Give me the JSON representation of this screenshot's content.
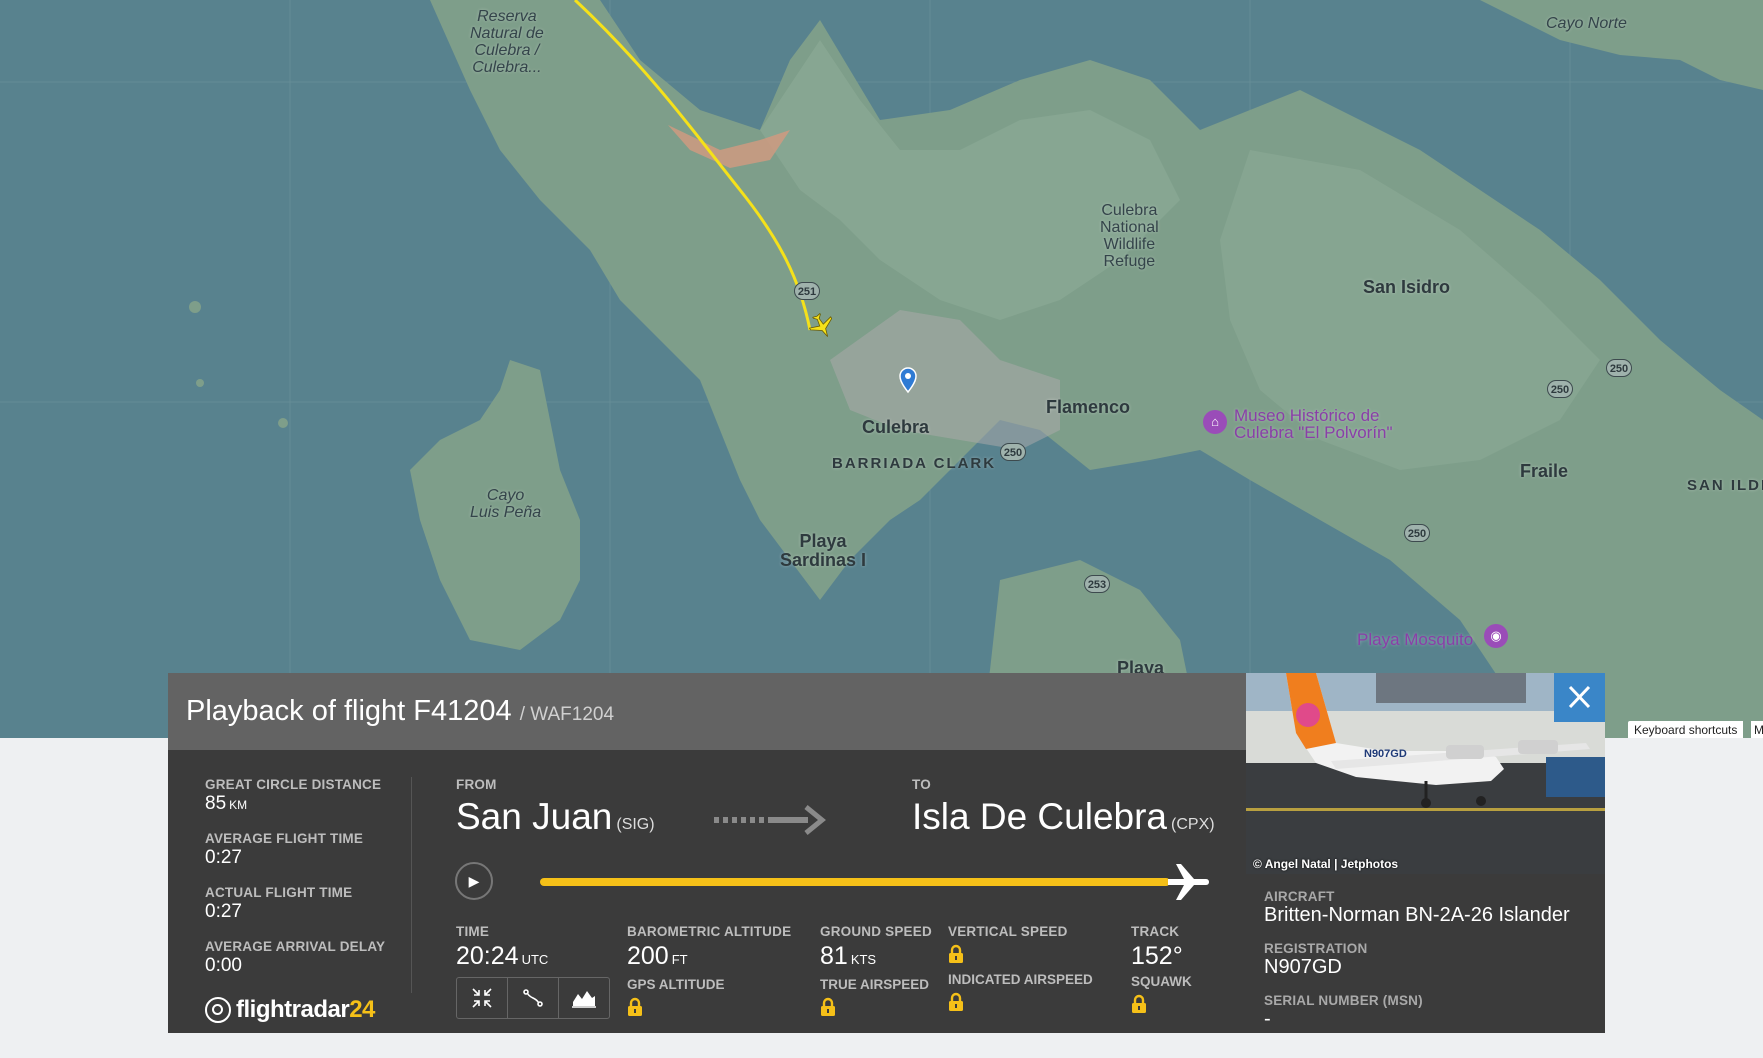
{
  "map": {
    "labels": {
      "reserva_line1": "Reserva",
      "reserva_line2": "Natural de",
      "reserva_line3": "Culebra /",
      "reserva_line4": "Culebra...",
      "cayo_norte": "Cayo Norte",
      "refuge_line1": "Culebra",
      "refuge_line2": "National",
      "refuge_line3": "Wildlife",
      "refuge_line4": "Refuge",
      "san_isidro": "San Isidro",
      "flamenco": "Flamenco",
      "culebra": "Culebra",
      "barriada_clark": "BARRIADA CLARK",
      "museo_line1": "Museo Histórico de",
      "museo_line2": "Culebra \"El Polvorín\"",
      "fraile": "Fraile",
      "san_ilde": "SAN ILDE",
      "cayo_luis_line1": "Cayo",
      "cayo_luis_line2": "Luis Peña",
      "playa_sardinas_line1": "Playa",
      "playa_sardinas_line2": "Sardinas I",
      "playa_mosquito": "Playa Mosquito",
      "playa_bottom": "Playa"
    },
    "road_shields": [
      "251",
      "250",
      "250",
      "250",
      "250",
      "253"
    ],
    "keyboard_shortcuts": "Keyboard shortcuts",
    "more_link": "M",
    "flight_path_color": "#f5e11a",
    "water_color": "#58828e",
    "land_color": "#7e9e8a"
  },
  "panel": {
    "title": "Playback of flight F41204",
    "subtitle": "/ WAF1204",
    "stats": [
      {
        "label": "GREAT CIRCLE DISTANCE",
        "value": "85",
        "unit": "KM"
      },
      {
        "label": "AVERAGE FLIGHT TIME",
        "value": "0:27"
      },
      {
        "label": "ACTUAL FLIGHT TIME",
        "value": "0:27"
      },
      {
        "label": "AVERAGE ARRIVAL DELAY",
        "value": "0:00"
      }
    ],
    "logo": {
      "text": "flightradar",
      "num": "24"
    },
    "route": {
      "from_label": "FROM",
      "from_city": "San Juan",
      "from_code": "(SIG)",
      "to_label": "TO",
      "to_city": "Isla De Culebra",
      "to_code": "(CPX)"
    },
    "playback": {
      "progress": 1.0,
      "accent": "#f5c018"
    },
    "metrics": {
      "time": {
        "label": "TIME",
        "value": "20:24",
        "unit": "UTC"
      },
      "baro_alt": {
        "label": "BAROMETRIC ALTITUDE",
        "value": "200",
        "unit": "FT",
        "sub_label": "GPS ALTITUDE"
      },
      "ground_speed": {
        "label": "GROUND SPEED",
        "value": "81",
        "unit": "KTS",
        "sub_label": "TRUE AIRSPEED"
      },
      "vertical_speed": {
        "label": "VERTICAL SPEED",
        "sub_label": "INDICATED AIRSPEED"
      },
      "track": {
        "label": "TRACK",
        "value": "152°",
        "sub_label": "SQUAWK"
      }
    },
    "tools": [
      "collapse-icon",
      "route-icon",
      "chart-icon"
    ]
  },
  "aircraft": {
    "photo_credit": "© Angel Natal | Jetphotos",
    "photo_registration_text": "N907GD",
    "aircraft_label": "AIRCRAFT",
    "aircraft_value": "Britten-Norman BN-2A-26 Islander",
    "registration_label": "REGISTRATION",
    "registration_value": "N907GD",
    "serial_label": "SERIAL NUMBER (MSN)",
    "serial_value": "-"
  }
}
